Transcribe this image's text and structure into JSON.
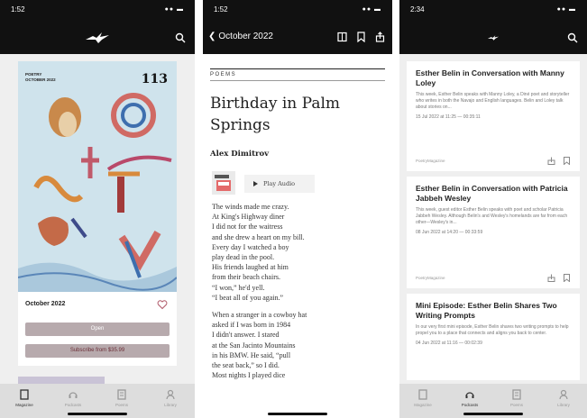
{
  "phone1": {
    "status_time": "1:52",
    "cover": {
      "tag": "POETRY\nOCTOBER 2022",
      "number": "113"
    },
    "issue_date": "October 2022",
    "open_label": "Open",
    "subscribe_label": "Subscribe from $35.99",
    "tabs": [
      {
        "label": "Magazine",
        "icon": "book-icon",
        "active": true
      },
      {
        "label": "Podcasts",
        "icon": "headphones-icon",
        "active": false
      },
      {
        "label": "Poems",
        "icon": "doc-icon",
        "active": false
      },
      {
        "label": "Library",
        "icon": "user-icon",
        "active": false
      }
    ]
  },
  "phone2": {
    "status_time": "1:52",
    "back_label": "October 2022",
    "section": "POEMS",
    "title": "Birthday in Palm Springs",
    "author": "Alex Dimitrov",
    "play_label": "Play Audio",
    "stanzas": [
      [
        "The winds made me crazy.",
        "At King's Highway diner",
        "I did not for the waitress",
        "and she drew a heart on my bill.",
        "Every day I watched a boy",
        "play dead in the pool.",
        "His friends laughed at him",
        "from their beach chairs.",
        "“I won,” he'd yell.",
        "“I beat all of you again.”"
      ],
      [
        "When a stranger in a cowboy hat",
        "asked if I was born in 1984",
        "I didn't answer. I stared",
        "at the San Jacinto Mountains",
        "in his BMW. He said, “pull",
        "the seat back,” so I did.",
        "Most nights I played dice"
      ]
    ]
  },
  "phone3": {
    "status_time": "2:34",
    "episodes": [
      {
        "title": "Esther Belin in Conversation with Manny Loley",
        "desc": "This week, Esther Belin speaks with Manny Loley, a Diné poet and storyteller who writes in both the Navajo and English languages. Belin and Loley talk about stories on...",
        "time": "15 Jul 2022 at 11:25 — 00:35:11",
        "brand": "PoetryMagazine"
      },
      {
        "title": "Esther Belin in Conversation with Patricia Jabbeh Wesley",
        "desc": "This week, guest editor Esther Belin speaks with poet and scholar Patricia Jabbeh Wesley. Although Belin's and Wesley's homelands are far from each other—Wesley's in...",
        "time": "08 Jun 2022 at 14:20 — 00:33:59",
        "brand": "PoetryMagazine"
      },
      {
        "title": "Mini Episode: Esther Belin Shares Two Writing Prompts",
        "desc": "In our very first mini episode, Esther Belin shares two writing prompts to help propel you to a place that connects and aligns you back to center.",
        "time": "04 Jun 2022 at 11:16 — 00:02:39",
        "brand": ""
      }
    ],
    "tabs": [
      {
        "label": "Magazine",
        "icon": "book-icon",
        "active": false
      },
      {
        "label": "Podcasts",
        "icon": "headphones-icon",
        "active": true
      },
      {
        "label": "Poems",
        "icon": "doc-icon",
        "active": false
      },
      {
        "label": "Library",
        "icon": "user-icon",
        "active": false
      }
    ]
  }
}
